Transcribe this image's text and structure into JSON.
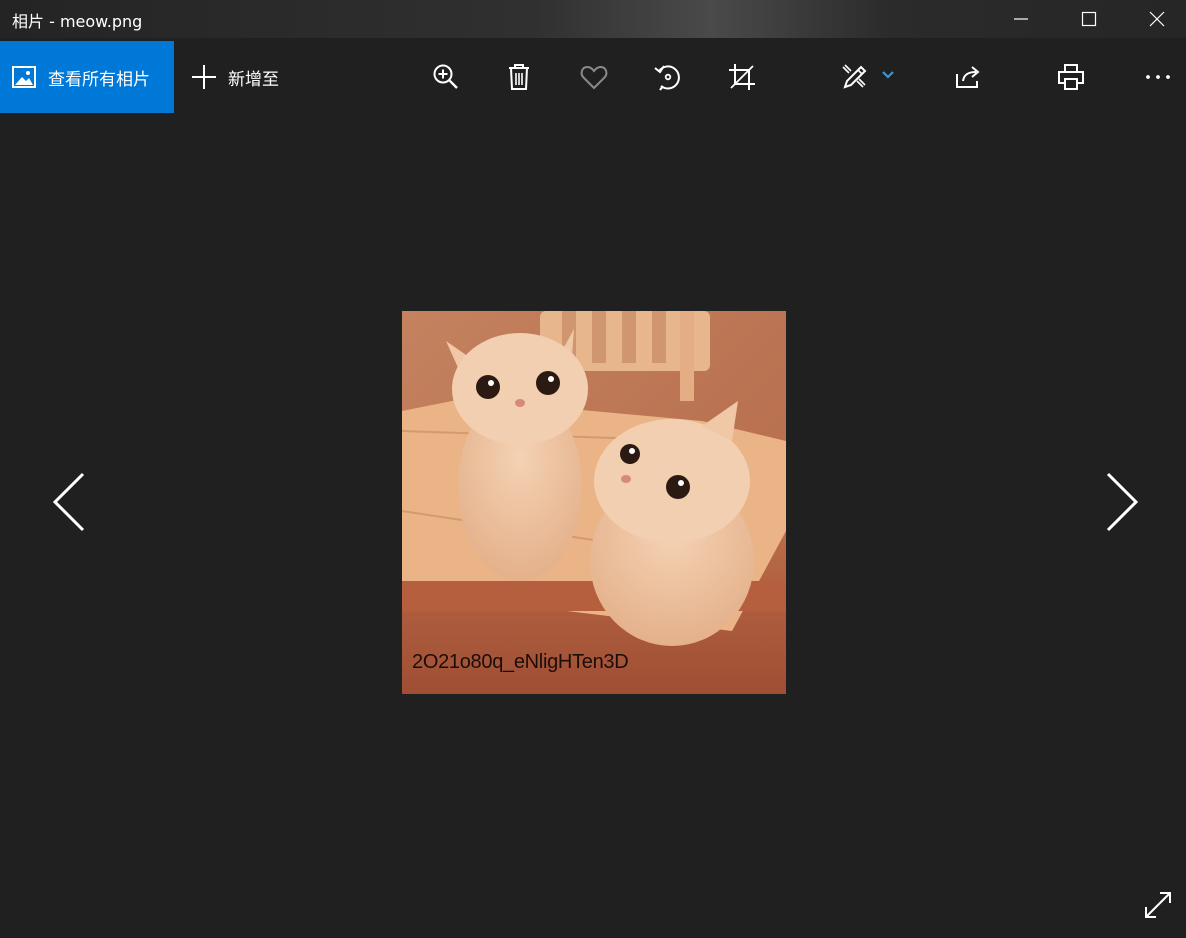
{
  "window": {
    "title": "相片 - meow.png"
  },
  "commandbar": {
    "view_all_label": "查看所有相片",
    "add_to_label": "新增至",
    "tools": [
      "zoom-in-icon",
      "delete-icon",
      "favorite-icon",
      "rotate-icon",
      "crop-icon",
      "edit-icon",
      "share-icon",
      "print-icon",
      "more-icon"
    ]
  },
  "photo": {
    "filename": "meow.png",
    "caption": "2O21o80q_eNligHTen3D"
  },
  "colors": {
    "accent": "#0078d7",
    "background": "#202020",
    "dropdown_chevron": "#3a96dd"
  }
}
